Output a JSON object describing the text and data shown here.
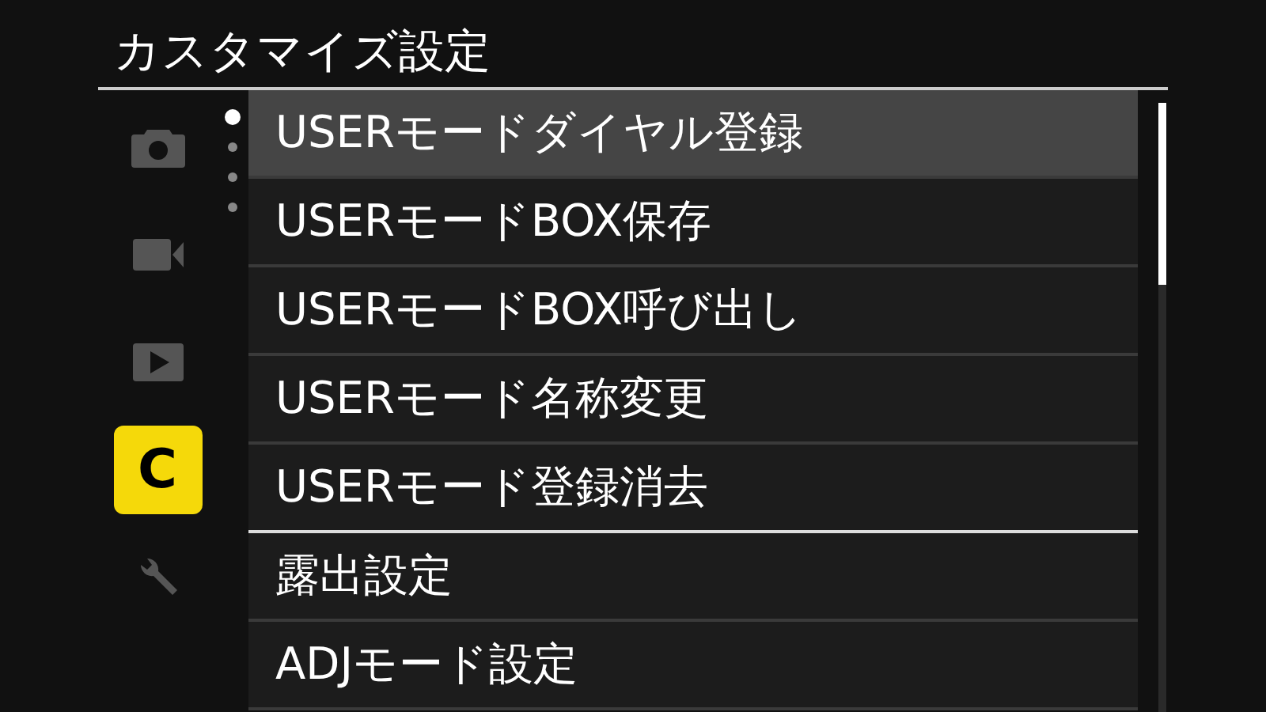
{
  "title": "カスタマイズ設定",
  "tabs": [
    {
      "kind": "camera",
      "selected": false
    },
    {
      "kind": "video",
      "selected": false
    },
    {
      "kind": "playback",
      "selected": false
    },
    {
      "kind": "custom",
      "label": "C",
      "selected": true
    },
    {
      "kind": "wrench",
      "selected": false
    }
  ],
  "page_dots": [
    {
      "selected": true
    },
    {
      "selected": false
    },
    {
      "selected": false
    },
    {
      "selected": false
    }
  ],
  "items": [
    {
      "label": "USERモードダイヤル登録",
      "selected": true,
      "group_end": false
    },
    {
      "label": "USERモードBOX保存",
      "selected": false,
      "group_end": false
    },
    {
      "label": "USERモードBOX呼び出し",
      "selected": false,
      "group_end": false
    },
    {
      "label": "USERモード名称変更",
      "selected": false,
      "group_end": false
    },
    {
      "label": "USERモード登録消去",
      "selected": false,
      "group_end": true
    },
    {
      "label": "露出設定",
      "selected": false,
      "group_end": false
    },
    {
      "label": "ADJモード設定",
      "selected": false,
      "group_end": false
    }
  ]
}
